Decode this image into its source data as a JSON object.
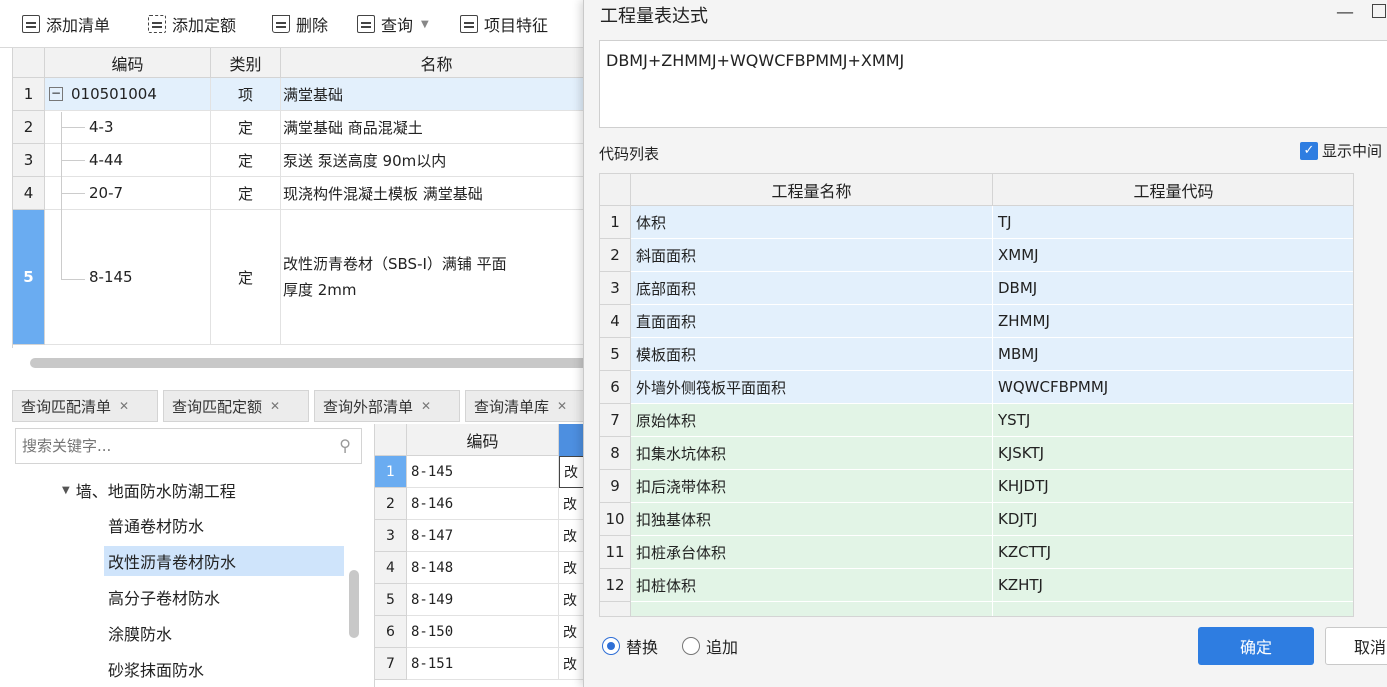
{
  "toolbar": {
    "add_list": "添加清单",
    "add_quota": "添加定额",
    "delete": "删除",
    "query": "查询",
    "item_feature": "项目特征"
  },
  "main_grid": {
    "headers": [
      "编码",
      "类别",
      "名称"
    ],
    "rows": [
      {
        "no": "1",
        "code": "010501004",
        "type": "项",
        "name": "满堂基础",
        "name2": ""
      },
      {
        "no": "2",
        "code": "4-3",
        "type": "定",
        "name": "满堂基础 商品混凝土",
        "name2": ""
      },
      {
        "no": "3",
        "code": "4-44",
        "type": "定",
        "name": "泵送 泵送高度 90m以内",
        "name2": ""
      },
      {
        "no": "4",
        "code": "20-7",
        "type": "定",
        "name": "现浇构件混凝土模板 满堂基础",
        "name2": ""
      },
      {
        "no": "5",
        "code": "8-145",
        "type": "定",
        "name": "改性沥青卷材（SBS-Ⅰ）满铺 平面",
        "name2": "厚度 2mm"
      }
    ]
  },
  "bottom_tabs": [
    "查询匹配清单",
    "查询匹配定额",
    "查询外部清单",
    "查询清单库"
  ],
  "search": {
    "placeholder": "搜索关键字..."
  },
  "tree": {
    "parent": "墙、地面防水防潮工程",
    "children": [
      "普通卷材防水",
      "改性沥青卷材防水",
      "高分子卷材防水",
      "涂膜防水",
      "砂浆抹面防水"
    ]
  },
  "lower_grid": {
    "header": "编码",
    "rows": [
      {
        "no": "1",
        "code": "8-145",
        "name": "改"
      },
      {
        "no": "2",
        "code": "8-146",
        "name": "改"
      },
      {
        "no": "3",
        "code": "8-147",
        "name": "改"
      },
      {
        "no": "4",
        "code": "8-148",
        "name": "改"
      },
      {
        "no": "5",
        "code": "8-149",
        "name": "改"
      },
      {
        "no": "6",
        "code": "8-150",
        "name": "改"
      },
      {
        "no": "7",
        "code": "8-151",
        "name": "改"
      }
    ]
  },
  "dialog": {
    "title": "工程量表达式",
    "expression": "DBMJ+ZHMMJ+WQWCFBPMMJ+XMMJ",
    "code_list_label": "代码列表",
    "show_cn_label": "显示中间",
    "headers": [
      "工程量名称",
      "工程量代码"
    ],
    "rows": [
      {
        "no": "1",
        "name": "体积",
        "code": "TJ",
        "group": "blue"
      },
      {
        "no": "2",
        "name": "斜面面积",
        "code": "XMMJ",
        "group": "blue"
      },
      {
        "no": "3",
        "name": "底部面积",
        "code": "DBMJ",
        "group": "blue"
      },
      {
        "no": "4",
        "name": "直面面积",
        "code": "ZHMMJ",
        "group": "blue"
      },
      {
        "no": "5",
        "name": "模板面积",
        "code": "MBMJ",
        "group": "blue"
      },
      {
        "no": "6",
        "name": "外墙外侧筏板平面面积",
        "code": "WQWCFBPMMJ",
        "group": "blue"
      },
      {
        "no": "7",
        "name": "原始体积",
        "code": "YSTJ",
        "group": "green"
      },
      {
        "no": "8",
        "name": "扣集水坑体积",
        "code": "KJSKTJ",
        "group": "green"
      },
      {
        "no": "9",
        "name": "扣后浇带体积",
        "code": "KHJDTJ",
        "group": "green"
      },
      {
        "no": "10",
        "name": "扣独基体积",
        "code": "KDJTJ",
        "group": "green"
      },
      {
        "no": "11",
        "name": "扣桩承台体积",
        "code": "KZCTTJ",
        "group": "green"
      },
      {
        "no": "12",
        "name": "扣桩体积",
        "code": "KZHTJ",
        "group": "green"
      }
    ],
    "radio_replace": "替换",
    "radio_append": "追加",
    "ok": "确定",
    "cancel": "取消"
  },
  "colors": {
    "accent": "#2e7de1",
    "row_blue": "#e3f0fc",
    "row_green": "#e2f4e6",
    "selected": "#6aacf1"
  }
}
